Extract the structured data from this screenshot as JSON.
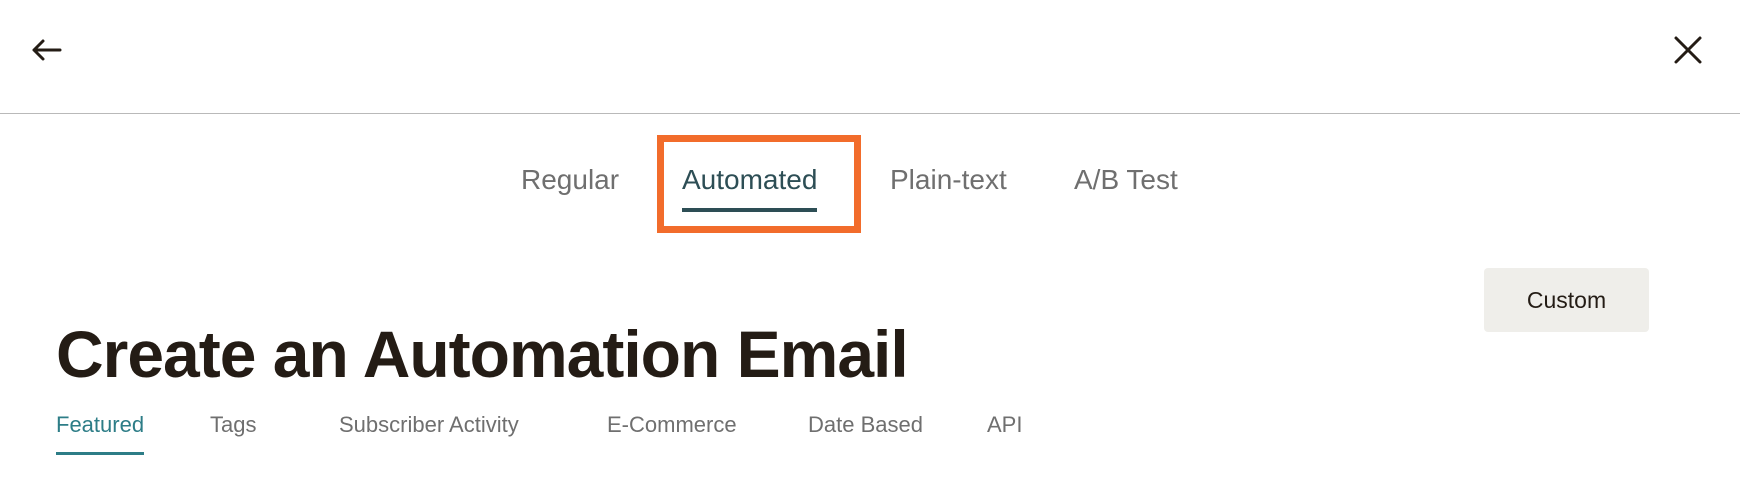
{
  "header": {
    "back_icon": "arrow-left-icon",
    "close_icon": "close-icon"
  },
  "type_tabs": [
    {
      "label": "Regular",
      "active": false
    },
    {
      "label": "Automated",
      "active": true
    },
    {
      "label": "Plain-text",
      "active": false
    },
    {
      "label": "A/B Test",
      "active": false
    }
  ],
  "page": {
    "title": "Create an Automation Email",
    "custom_button_label": "Custom"
  },
  "category_tabs": [
    {
      "label": "Featured",
      "active": true
    },
    {
      "label": "Tags",
      "active": false
    },
    {
      "label": "Subscriber Activity",
      "active": false
    },
    {
      "label": "E-Commerce",
      "active": false
    },
    {
      "label": "Date Based",
      "active": false
    },
    {
      "label": "API",
      "active": false
    }
  ],
  "colors": {
    "active_type_tab": "#2d4e55",
    "active_category_tab": "#2d7d87",
    "highlight_border": "#f26c2b",
    "custom_button_bg": "#efeeea",
    "title_text": "#241c15"
  }
}
